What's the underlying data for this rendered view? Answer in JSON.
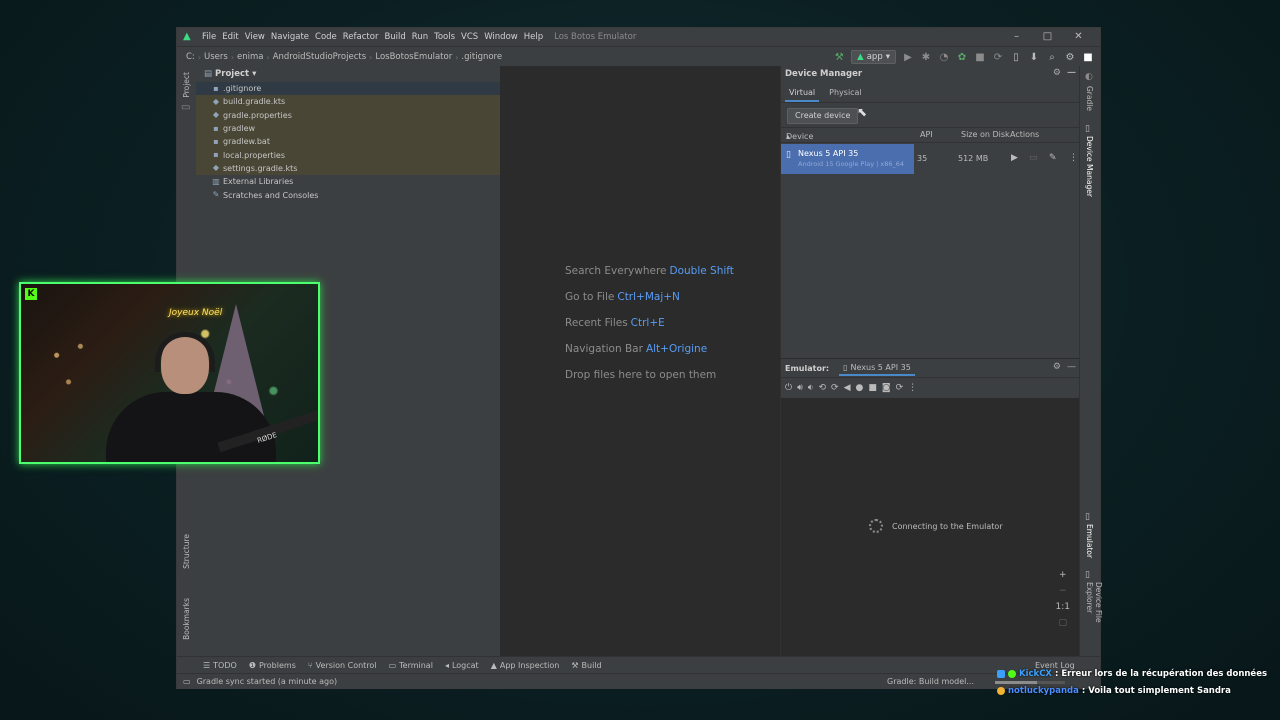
{
  "window": {
    "title": "Los Botos Emulator",
    "menu": [
      "File",
      "Edit",
      "View",
      "Navigate",
      "Code",
      "Refactor",
      "Build",
      "Run",
      "Tools",
      "VCS",
      "Window",
      "Help"
    ]
  },
  "breadcrumb": [
    "C:",
    "Users",
    "enima",
    "AndroidStudioProjects",
    "LosBotosEmulator",
    ".gitignore"
  ],
  "run_config": "app",
  "project_panel": {
    "title": "Project",
    "items": [
      {
        "label": ".gitignore",
        "icon": "file-icon"
      },
      {
        "label": "build.gradle.kts",
        "icon": "gradle-icon"
      },
      {
        "label": "gradle.properties",
        "icon": "gradle-icon"
      },
      {
        "label": "gradlew",
        "icon": "file-icon"
      },
      {
        "label": "gradlew.bat",
        "icon": "file-icon"
      },
      {
        "label": "local.properties",
        "icon": "settings-icon"
      },
      {
        "label": "settings.gradle.kts",
        "icon": "gradle-icon"
      },
      {
        "label": "External Libraries",
        "icon": "library-icon"
      },
      {
        "label": "Scratches and Consoles",
        "icon": "scratches-icon"
      }
    ]
  },
  "left_stripe": {
    "project": "Project",
    "structure": "Structure",
    "bookmarks": "Bookmarks"
  },
  "editor_hints": [
    {
      "text": "Search Everywhere",
      "key": "Double Shift"
    },
    {
      "text": "Go to File",
      "key": "Ctrl+Maj+N"
    },
    {
      "text": "Recent Files",
      "key": "Ctrl+E"
    },
    {
      "text": "Navigation Bar",
      "key": "Alt+Origine"
    },
    {
      "text": "Drop files here to open them",
      "key": ""
    }
  ],
  "device_manager": {
    "title": "Device Manager",
    "tabs": [
      "Virtual",
      "Physical"
    ],
    "active_tab": "Virtual",
    "create_button": "Create device",
    "columns": {
      "device": "Device",
      "api": "API",
      "size": "Size on Disk",
      "actions": "Actions"
    },
    "devices": [
      {
        "name": "Nexus 5 API 35",
        "subtitle": "Android 15 Google Play | x86_64",
        "api": "35",
        "size": "512 MB"
      }
    ]
  },
  "emulator": {
    "label": "Emulator:",
    "tab": "Nexus 5 API 35",
    "status": "Connecting to the Emulator",
    "zoom_label": "1:1"
  },
  "right_stripe": {
    "gradle": "Gradle",
    "device_manager": "Device Manager",
    "emulator": "Emulator",
    "device_file_explorer": "Device File Explorer"
  },
  "bottom_tools": [
    "TODO",
    "Problems",
    "Version Control",
    "Terminal",
    "Logcat",
    "App Inspection",
    "Build"
  ],
  "status_bar": {
    "message": "Gradle sync started (a minute ago)",
    "right": "Gradle: Build model...",
    "progress": 0.6,
    "event_log": "Event Log"
  },
  "webcam": {
    "sign": "Joyeux Noël",
    "mic_brand": "RØDE"
  },
  "chat": [
    {
      "user": "KickCX",
      "message": ": Erreur lors de la récupération des données"
    },
    {
      "user": "notluckypanda",
      "message": ": Voila tout simplement Sandra"
    }
  ],
  "colors": {
    "accent": "#4a88c7",
    "selection": "#4b6eaf",
    "kick_green": "#53fc18"
  }
}
